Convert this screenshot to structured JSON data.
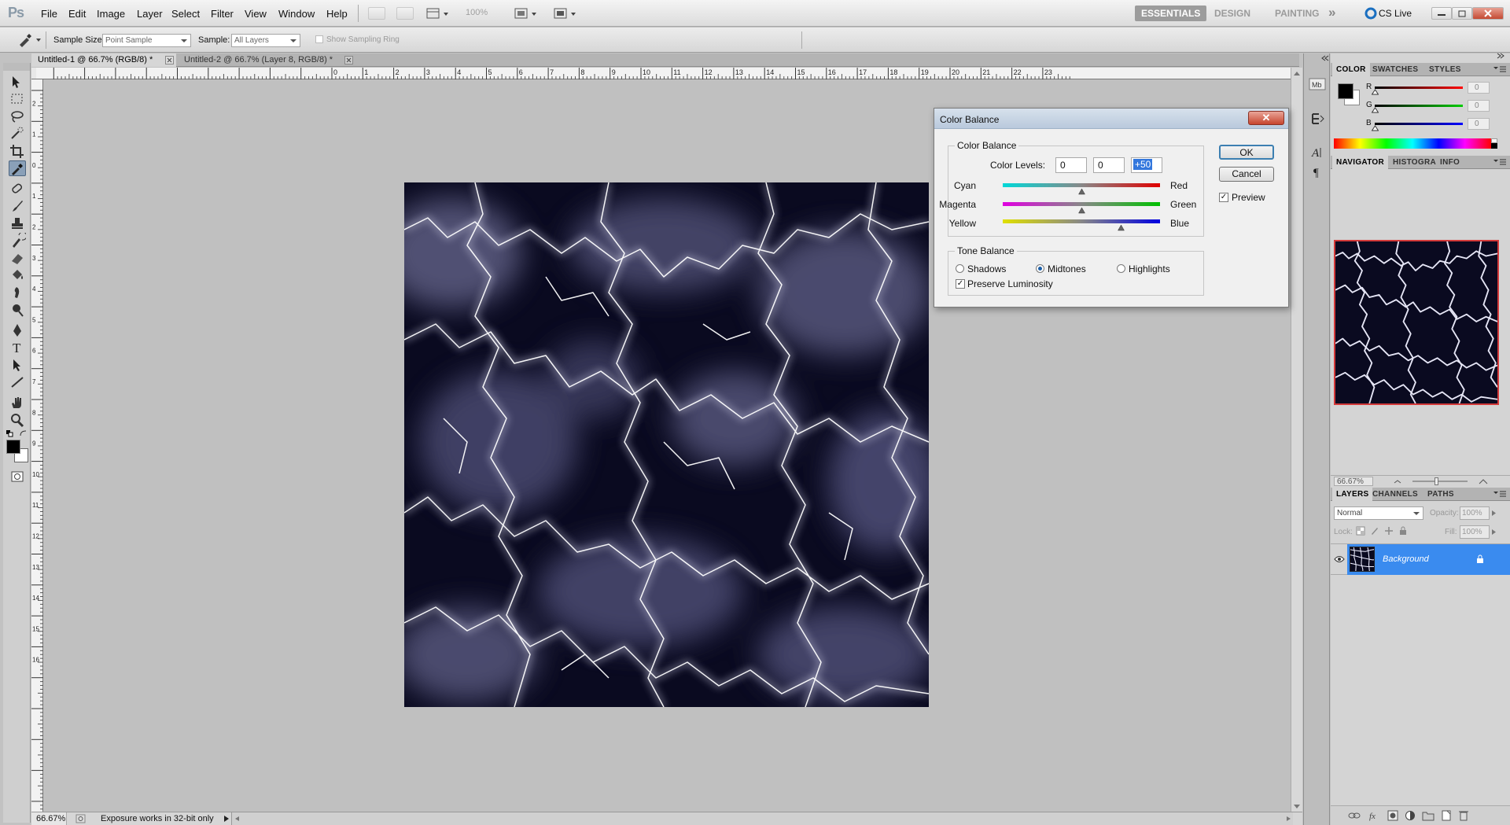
{
  "app": {
    "logo": "Ps",
    "menus": [
      "File",
      "Edit",
      "Image",
      "Layer",
      "Select",
      "Filter",
      "View",
      "Window",
      "Help"
    ],
    "zoom_menu": "100%",
    "workspaces": [
      "ESSENTIALS",
      "DESIGN",
      "PAINTING"
    ],
    "more_label": "»",
    "cs_live": "CS Live"
  },
  "options": {
    "sample_size_label": "Sample Size:",
    "sample_size_value": "Point Sample",
    "sample_label": "Sample:",
    "sample_value": "All Layers",
    "show_ring_label": "Show Sampling Ring"
  },
  "tabs": [
    {
      "label": "Untitled-1 @ 66.7% (RGB/8) *",
      "active": true
    },
    {
      "label": "Untitled-2 @ 66.7% (Layer 8, RGB/8) *",
      "active": false
    }
  ],
  "ruler": {
    "top": [
      "1",
      "2",
      "3",
      "4",
      "5",
      "6",
      "7",
      "8",
      "9",
      "10",
      "11",
      "12",
      "13",
      "14",
      "15",
      "16",
      "17",
      "18",
      "19",
      "20",
      "21",
      "22",
      "23"
    ],
    "left_top": "1",
    "left": [
      "2",
      "1",
      "0",
      "1",
      "2",
      "3",
      "4",
      "5",
      "6",
      "7",
      "8",
      "9",
      "10",
      "11",
      "12",
      "13",
      "14",
      "15",
      "16"
    ]
  },
  "status": {
    "zoom": "66.67%",
    "message": "Exposure works in 32-bit only"
  },
  "color_panel": {
    "tabs": [
      "COLOR",
      "SWATCHES",
      "STYLES"
    ],
    "channels": [
      {
        "label": "R",
        "value": "0",
        "color": "#ff0000"
      },
      {
        "label": "G",
        "value": "0",
        "color": "#00cc00"
      },
      {
        "label": "B",
        "value": "0",
        "color": "#0000ff"
      }
    ],
    "foreground": "#000000",
    "background": "#ffffff"
  },
  "navigator_panel": {
    "tabs": [
      "NAVIGATOR",
      "HISTOGRAM",
      "INFO"
    ],
    "zoom": "66.67%"
  },
  "layers_panel": {
    "tabs": [
      "LAYERS",
      "CHANNELS",
      "PATHS"
    ],
    "blend_mode": "Normal",
    "opacity_label": "Opacity:",
    "opacity_value": "100%",
    "lock_label": "Lock:",
    "fill_label": "Fill:",
    "fill_value": "100%",
    "layers": [
      {
        "name": "Background",
        "selected": true
      }
    ]
  },
  "dialog": {
    "title": "Color Balance",
    "close_symbol": "✕",
    "color_balance_group": "Color Balance",
    "color_levels_label": "Color Levels:",
    "levels": [
      "0",
      "0",
      "+50"
    ],
    "sliders": [
      {
        "left": "Cyan",
        "right": "Red",
        "value": 0
      },
      {
        "left": "Magenta",
        "right": "Green",
        "value": 0
      },
      {
        "left": "Yellow",
        "right": "Blue",
        "value": 50
      }
    ],
    "tone_balance_group": "Tone Balance",
    "tones": [
      {
        "label": "Shadows",
        "selected": false
      },
      {
        "label": "Midtones",
        "selected": true
      },
      {
        "label": "Highlights",
        "selected": false
      }
    ],
    "preserve_luminosity_label": "Preserve Luminosity",
    "preserve_luminosity": true,
    "ok_label": "OK",
    "cancel_label": "Cancel",
    "preview_label": "Preview",
    "preview": true
  }
}
